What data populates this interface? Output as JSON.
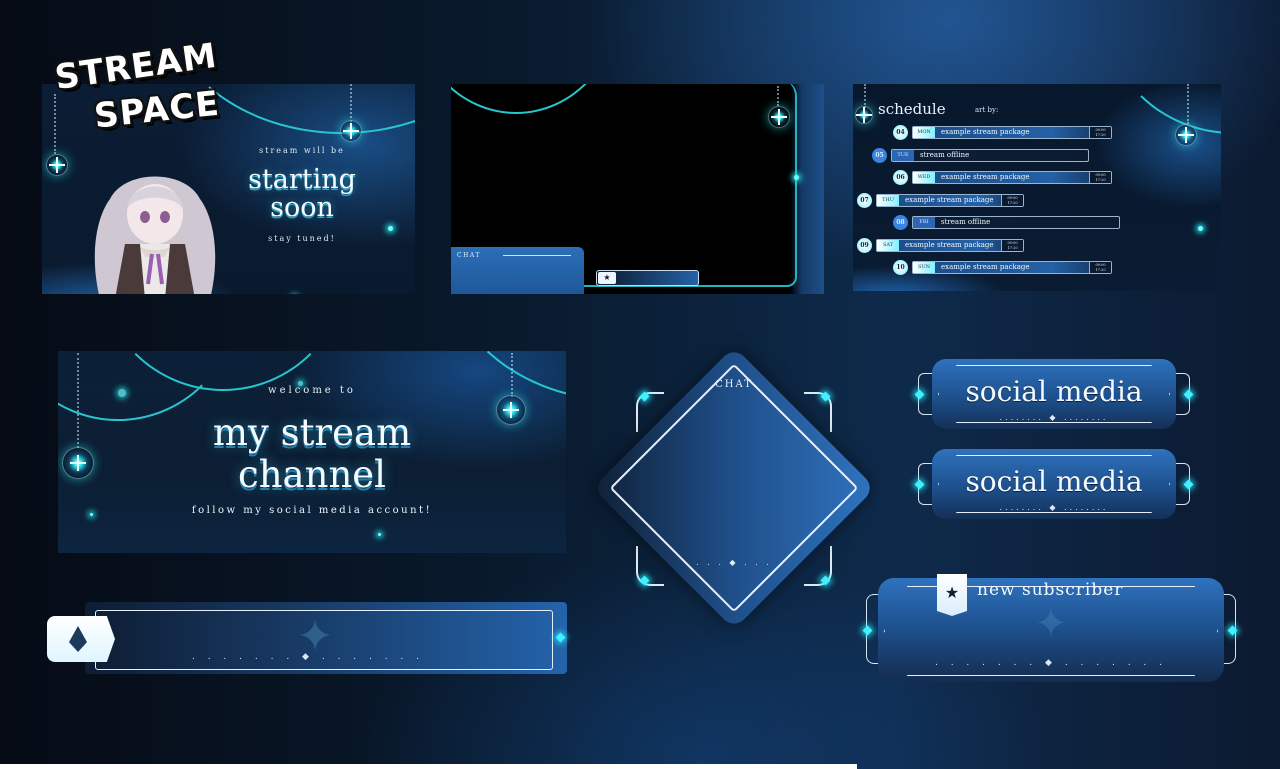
{
  "logo": {
    "line1": "STREAM",
    "line2": "SPACE"
  },
  "starting_soon": {
    "pre": "stream will be",
    "title_line1": "starting",
    "title_line2": "soon",
    "post": "stay tuned!"
  },
  "gameplay_overlay": {
    "chat_label": "CHAT",
    "alert_icon": "star-icon"
  },
  "schedule": {
    "title": "schedule",
    "art_by": "art by:",
    "rows": [
      {
        "num": "04",
        "day": "MON",
        "text": "example stream package",
        "time_start": "09:00",
        "time_end": "17:20",
        "status": "online"
      },
      {
        "num": "05",
        "day": "TUE",
        "text": "stream offline",
        "status": "offline"
      },
      {
        "num": "06",
        "day": "WED",
        "text": "example stream package",
        "time_start": "09:00",
        "time_end": "17:20",
        "status": "online"
      },
      {
        "num": "07",
        "day": "THU",
        "text": "example stream package",
        "time_start": "09:00",
        "time_end": "17:20",
        "status": "online"
      },
      {
        "num": "08",
        "day": "FRI",
        "text": "stream offline",
        "status": "offline"
      },
      {
        "num": "09",
        "day": "SAT",
        "text": "example stream package",
        "time_start": "09:00",
        "time_end": "17:20",
        "status": "online"
      },
      {
        "num": "10",
        "day": "SUN",
        "text": "example stream package",
        "time_start": "09:00",
        "time_end": "17:20",
        "status": "online"
      }
    ]
  },
  "banner": {
    "welcome": "welcome to",
    "title_line1": "my stream",
    "title_line2": "channel",
    "subtitle": "follow my social media account!"
  },
  "diamond_chat": {
    "label": "CHAT",
    "dots": ". . .   ◆   . . ."
  },
  "social_panels": [
    {
      "label": "social media",
      "dots": "........  ◆  ........"
    },
    {
      "label": "social media",
      "dots": "........  ◆  ........"
    }
  ],
  "subscriber_alert": {
    "label": "new subscriber",
    "icon": "star-icon",
    "dots": ". . . . . . .   ◆   . . . . . . ."
  },
  "name_bar": {
    "icon": "diamond-icon",
    "dots": ". . . . . . .   ◆   . . . . . . ."
  },
  "colors": {
    "accent_cyan": "#3ff0ff",
    "panel_blue": "#2f72be",
    "background_dark": "#07101d"
  }
}
